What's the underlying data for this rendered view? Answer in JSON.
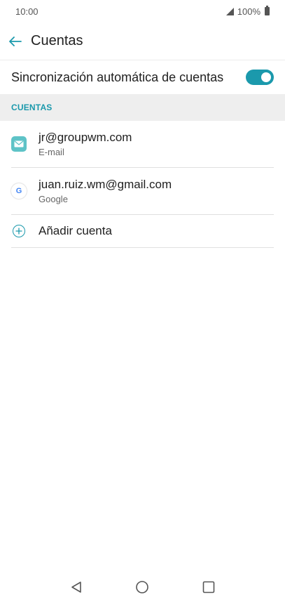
{
  "status_bar": {
    "time": "10:00",
    "battery": "100%"
  },
  "app_bar": {
    "title": "Cuentas"
  },
  "sync": {
    "label": "Sincronización automática de cuentas",
    "enabled": true
  },
  "section": {
    "header": "CUENTAS"
  },
  "accounts": [
    {
      "name": "jr@groupwm.com",
      "type": "E-mail",
      "icon": "email-icon"
    },
    {
      "name": "juan.ruiz.wm@gmail.com",
      "type": "Google",
      "icon": "google-icon"
    }
  ],
  "add_account": {
    "label": "Añadir cuenta",
    "icon": "plus-icon"
  },
  "google_glyph": "G",
  "colors": {
    "accent": "#1b99ac",
    "email_icon_bg": "#5ec3c7",
    "section_bg": "#eeeeee"
  },
  "nav": {
    "back": "back-triangle-icon",
    "home": "home-circle-icon",
    "recents": "recents-square-icon"
  }
}
